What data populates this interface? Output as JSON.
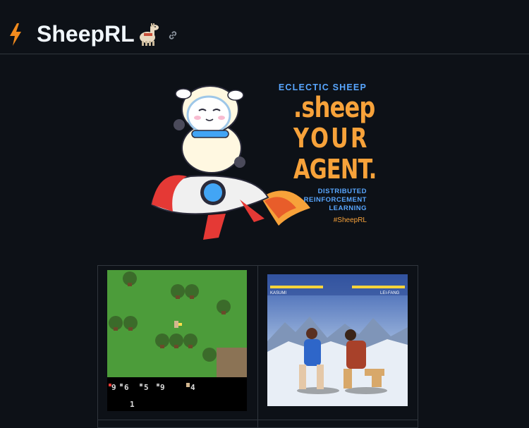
{
  "repo": {
    "title": "SheepRL",
    "title_emoji": "🦙"
  },
  "logo": {
    "eclectic": "ECLECTIC SHEEP",
    "line1": ".sheep",
    "line2": "YOUR",
    "line3": "AGENT.",
    "drl_line1": "DISTRIBUTED",
    "drl_line2": "REINFORCEMENT",
    "drl_line3": "LEARNING",
    "hashtag": "#SheepRL"
  },
  "colors": {
    "background": "#0d1117",
    "accent_orange": "#f7a23a",
    "accent_blue": "#58a6ff"
  },
  "games": [
    {
      "name": "crafter-screenshot",
      "hud": [
        "9",
        "6",
        "5",
        "9",
        "4",
        "1"
      ]
    },
    {
      "name": "fighting-game-screenshot",
      "hud": [
        "KASUMI",
        "LEI-FANG"
      ]
    }
  ],
  "icons": [
    "lightning-bolt-icon",
    "llama-icon",
    "link-icon"
  ]
}
